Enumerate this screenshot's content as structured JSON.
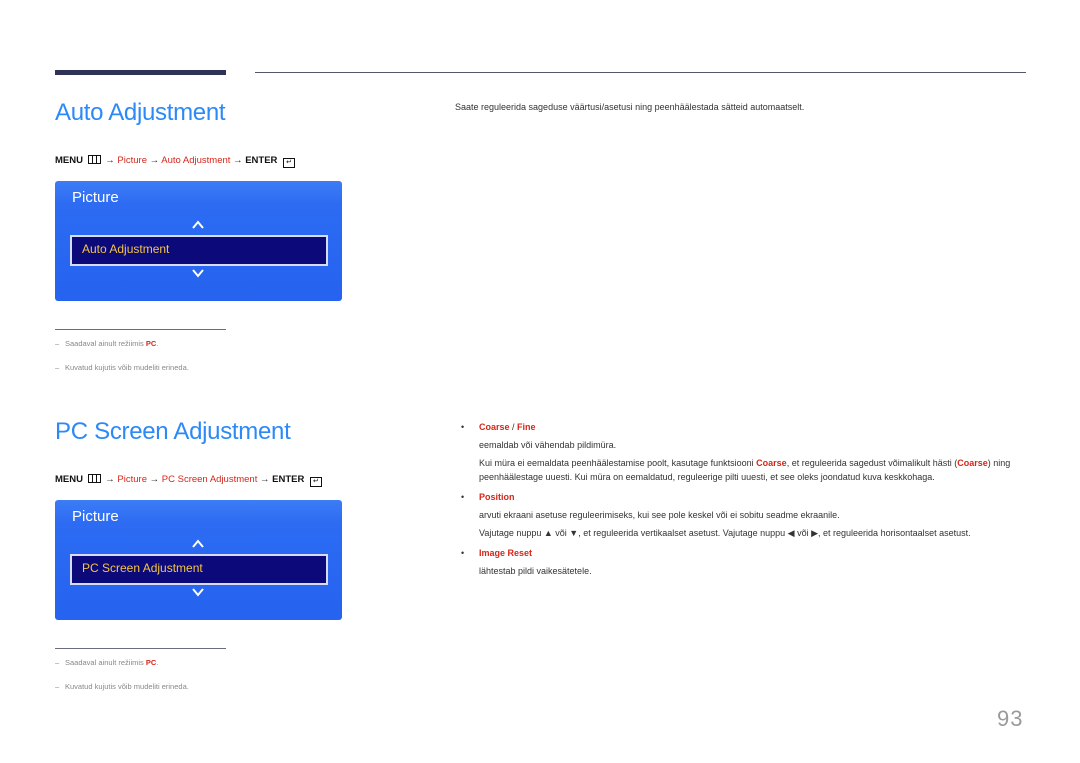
{
  "sections": [
    {
      "title": "Auto Adjustment",
      "path": {
        "menu": "MENU",
        "arrow": "→",
        "step1": "Picture",
        "step2": "Auto Adjustment",
        "enter": "ENTER"
      },
      "osd": {
        "title": "Picture",
        "selected": "Auto Adjustment"
      },
      "notes": [
        {
          "text": "Saadaval ainult režiimis ",
          "highlight": "PC",
          "suffix": "."
        },
        {
          "text": "Kuvatud kujutis võib mudeliti erineda."
        }
      ],
      "description": "Saate reguleerida sageduse väärtusi/asetusi ning peenhäälestada sätteid automaatselt."
    },
    {
      "title": "PC Screen Adjustment",
      "path": {
        "menu": "MENU",
        "arrow": "→",
        "step1": "Picture",
        "step2": "PC Screen Adjustment",
        "enter": "ENTER"
      },
      "osd": {
        "title": "Picture",
        "selected": "PC Screen Adjustment"
      },
      "notes": [
        {
          "text": "Saadaval ainult režiimis ",
          "highlight": "PC",
          "suffix": "."
        },
        {
          "text": "Kuvatud kujutis võib mudeliti erineda."
        }
      ],
      "items": [
        {
          "head_a": "Coarse",
          "head_sep": " / ",
          "head_b": "Fine",
          "line1": "eemaldab või vähendab pildimüra.",
          "line2_a": "Kui müra ei eemaldata peenhäälestamise poolt, kasutage funktsiooni ",
          "line2_b": "Coarse",
          "line2_c": ", et reguleerida sagedust võimalikult hästi (",
          "line2_d": "Coarse",
          "line2_e": ") ning peenhäälestage uuesti. Kui müra on eemaldatud, reguleerige pilti uuesti, et see oleks joondatud kuva keskkohaga."
        },
        {
          "head_a": "Position",
          "line1": "arvuti ekraani asetuse reguleerimiseks, kui see pole keskel või ei sobitu seadme ekraanile.",
          "line2": "Vajutage nuppu ▲ või ▼, et reguleerida vertikaalset asetust. Vajutage nuppu ◀ või ▶, et reguleerida horisontaalset asetust."
        },
        {
          "head_a": "Image Reset",
          "line1": "lähtestab pildi vaikesätetele."
        }
      ]
    }
  ],
  "page_number": "93",
  "colors": {
    "heading": "#2b8af7",
    "accent": "#d6261a",
    "osd_bg": "#2563f0",
    "osd_selected": "#0c0a7a",
    "osd_selected_text": "#f5c542"
  }
}
